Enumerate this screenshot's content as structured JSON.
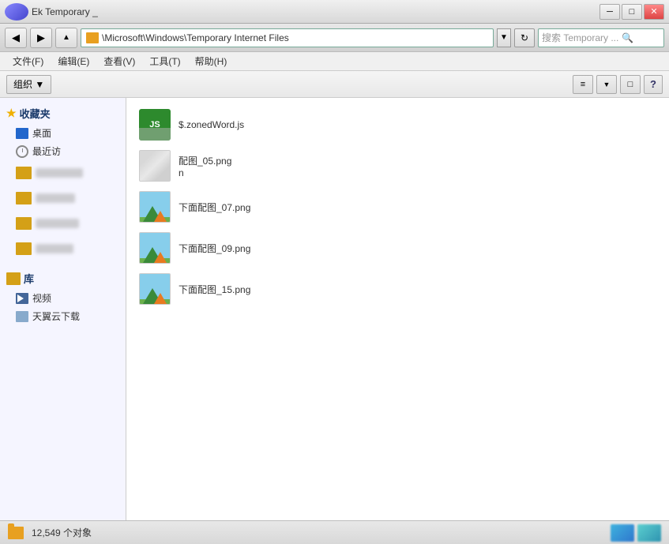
{
  "titleBar": {
    "title": "Ek Temporary _",
    "minBtn": "─",
    "maxBtn": "□",
    "closeBtn": "✕"
  },
  "addressBar": {
    "path": "\\Microsoft\\Windows\\Temporary Internet Files",
    "searchPlaceholder": "搜索 Temporary ...",
    "searchIcon": "🔍",
    "refreshIcon": "↻",
    "dropdownIcon": "▼"
  },
  "menuBar": {
    "items": [
      {
        "label": "文件(F)"
      },
      {
        "label": "编辑(E)"
      },
      {
        "label": "查看(V)"
      },
      {
        "label": "工具(T)"
      },
      {
        "label": "帮助(H)"
      }
    ]
  },
  "toolbar": {
    "organizeLabel": "组织 ▼",
    "viewIcon": "≡",
    "viewDropIcon": "▼",
    "windowIcon": "□",
    "helpIcon": "?"
  },
  "sidebar": {
    "favorites": {
      "header": "收藏夹",
      "items": [
        {
          "label": "桌面"
        },
        {
          "label": "最近访"
        }
      ]
    },
    "library": {
      "header": "库",
      "items": [
        {
          "label": "视频"
        },
        {
          "label": "天翼云下载"
        }
      ]
    }
  },
  "files": [
    {
      "name": "$.zonedWord.js",
      "type": "js"
    },
    {
      "name": "配图_05.png\nn",
      "type": "png-blurred"
    },
    {
      "name": "下面配图_07.png",
      "type": "image"
    },
    {
      "name": "下面配图_09.png",
      "type": "image"
    },
    {
      "name": "下面配图_15.png",
      "type": "image"
    }
  ],
  "statusBar": {
    "count": "12,549 个对象"
  }
}
